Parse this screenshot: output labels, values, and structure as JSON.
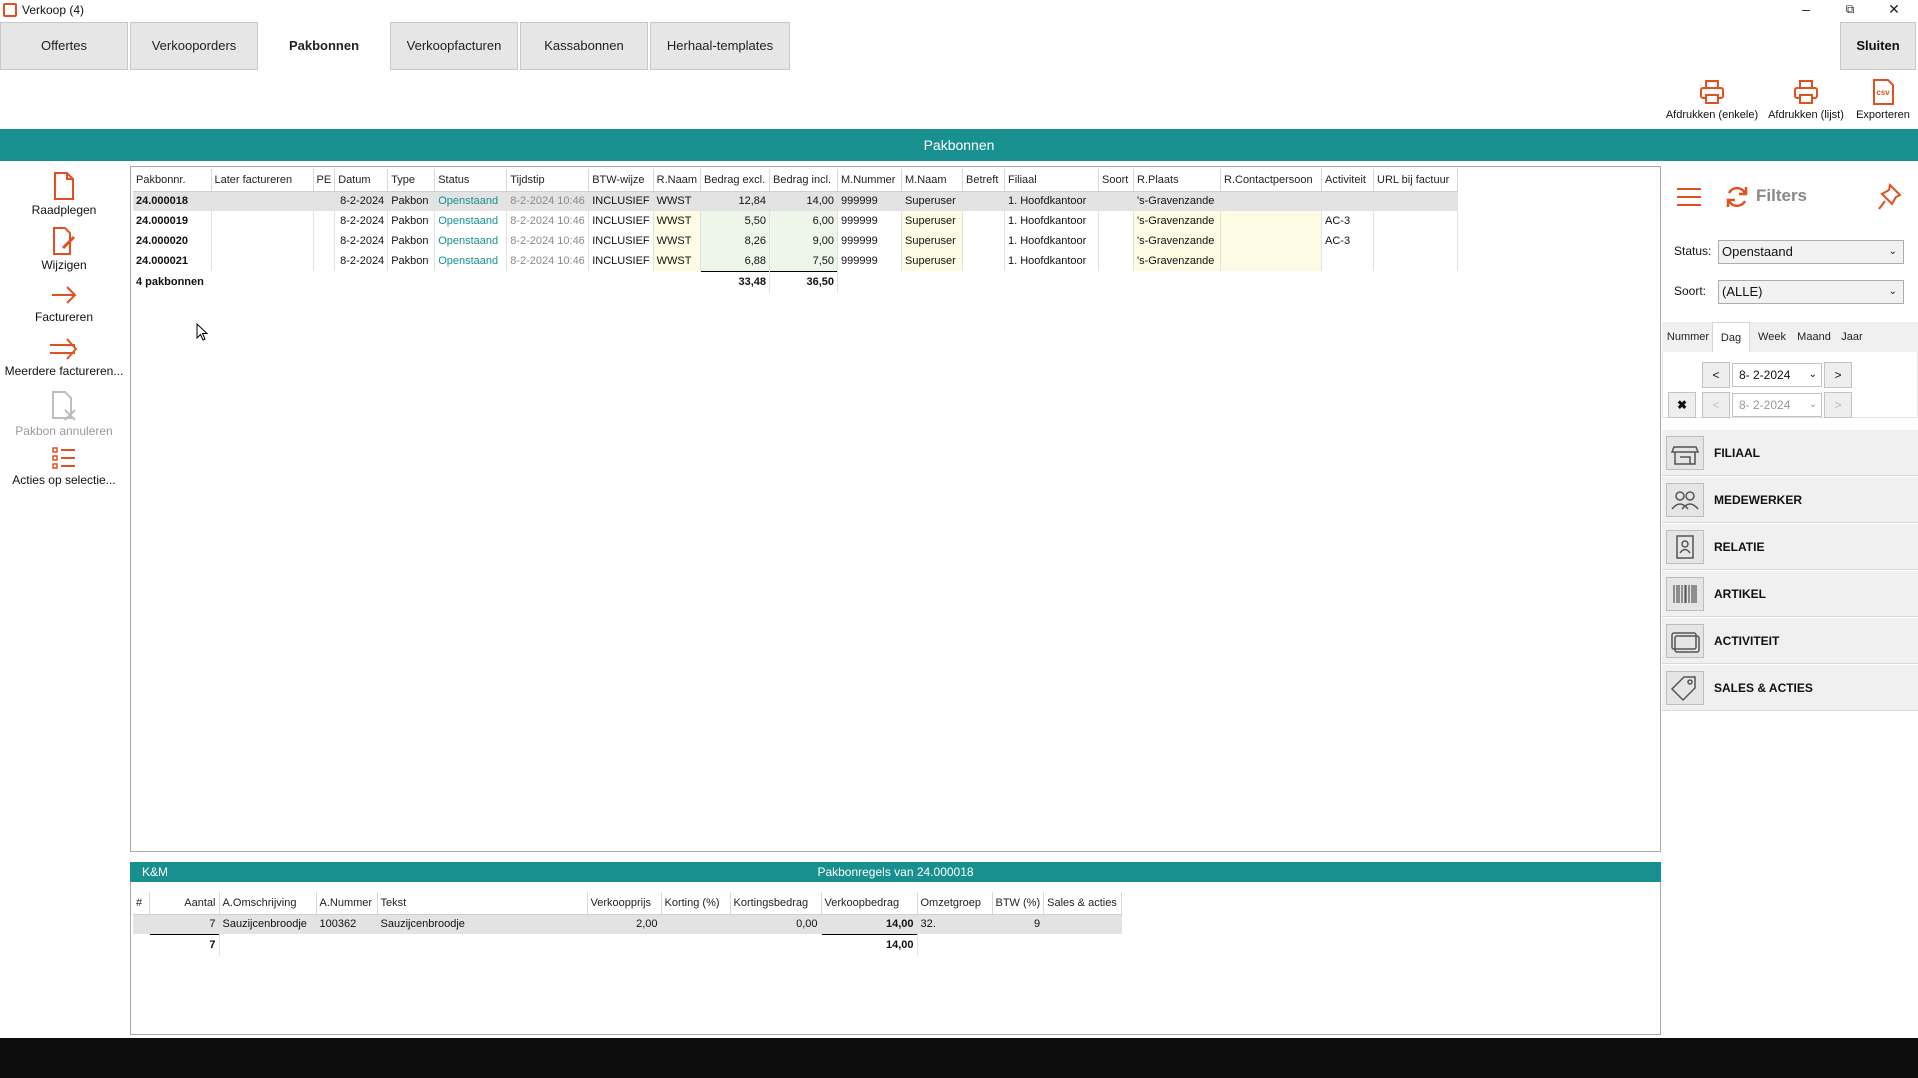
{
  "window": {
    "title": "Verkoop (4)"
  },
  "tabs": [
    "Offertes",
    "Verkooporders",
    "Pakbonnen",
    "Verkoopfacturen",
    "Kassabonnen",
    "Herhaal-templates"
  ],
  "close_label": "Sluiten",
  "top_actions": {
    "print_single": "Afdrukken (enkele)",
    "print_list": "Afdrukken (lijst)",
    "export": "Exporteren",
    "csv": "csv"
  },
  "banner": "Pakbonnen",
  "left_actions": {
    "raadplegen": "Raadplegen",
    "wijzigen": "Wijzigen",
    "factureren": "Factureren",
    "meerdere": "Meerdere factureren...",
    "annuleren": "Pakbon annuleren",
    "acties": "Acties op selectie..."
  },
  "grid": {
    "columns": [
      "Pakbonnr.",
      "Later factureren",
      "PE",
      "Datum",
      "Type",
      "Status",
      "Tijdstip",
      "BTW-wijze",
      "R.Naam",
      "Bedrag excl.",
      "Bedrag incl.",
      "M.Nummer",
      "M.Naam",
      "Betreft",
      "Filiaal",
      "Soort",
      "R.Plaats",
      "R.Contactpersoon",
      "Activiteit",
      "URL bij factuur"
    ],
    "rows": [
      [
        "24.000018",
        "",
        "",
        "8-2-2024",
        "Pakbon",
        "Openstaand",
        "8-2-2024 10:46",
        "INCLUSIEF",
        "WWST",
        "12,84",
        "14,00",
        "999999",
        "Superuser",
        "",
        "1. Hoofdkantoor",
        "",
        "'s-Gravenzande",
        "",
        "",
        ""
      ],
      [
        "24.000019",
        "",
        "",
        "8-2-2024",
        "Pakbon",
        "Openstaand",
        "8-2-2024 10:46",
        "INCLUSIEF",
        "WWST",
        "5,50",
        "6,00",
        "999999",
        "Superuser",
        "",
        "1. Hoofdkantoor",
        "",
        "'s-Gravenzande",
        "",
        "AC-3",
        ""
      ],
      [
        "24.000020",
        "",
        "",
        "8-2-2024",
        "Pakbon",
        "Openstaand",
        "8-2-2024 10:46",
        "INCLUSIEF",
        "WWST",
        "8,26",
        "9,00",
        "999999",
        "Superuser",
        "",
        "1. Hoofdkantoor",
        "",
        "'s-Gravenzande",
        "",
        "AC-3",
        ""
      ],
      [
        "24.000021",
        "",
        "",
        "8-2-2024",
        "Pakbon",
        "Openstaand",
        "8-2-2024 10:46",
        "INCLUSIEF",
        "WWST",
        "6,88",
        "7,50",
        "999999",
        "Superuser",
        "",
        "1. Hoofdkantoor",
        "",
        "'s-Gravenzande",
        "",
        "",
        ""
      ]
    ],
    "footer": {
      "count": "4 pakbonnen",
      "total_excl": "33,48",
      "total_incl": "36,50"
    }
  },
  "detail": {
    "left_title": "K&M",
    "title": "Pakbonregels van 24.000018",
    "columns": [
      "#",
      "Aantal",
      "A.Omschrijving",
      "A.Nummer",
      "Tekst",
      "Verkoopprijs",
      "Korting (%)",
      "Kortingsbedrag",
      "Verkoopbedrag",
      "Omzetgroep",
      "BTW (%)",
      "Sales & acties"
    ],
    "rows": [
      [
        "",
        "7",
        "Sauzijcenbroodje",
        "100362",
        "Sauzijcenbroodje",
        "2,00",
        "",
        "0,00",
        "14,00",
        "32.",
        "9",
        ""
      ]
    ],
    "footer": {
      "aantal": "7",
      "verkoopbedrag": "14,00"
    }
  },
  "filters": {
    "title": "Filters",
    "status_label": "Status:",
    "status_value": "Openstaand",
    "soort_label": "Soort:",
    "soort_value": "(ALLE)",
    "period_tabs": [
      "Nummer",
      "Dag",
      "Week",
      "Maand",
      "Jaar"
    ],
    "date_from": "8-  2-2024",
    "date_to": "8-  2-2024",
    "sections": [
      "FILIAAL",
      "MEDEWERKER",
      "RELATIE",
      "ARTIKEL",
      "ACTIVITEIT",
      "SALES & ACTIES"
    ]
  },
  "colors": {
    "accent": "#17908f",
    "icon_orange": "#e2501f"
  }
}
